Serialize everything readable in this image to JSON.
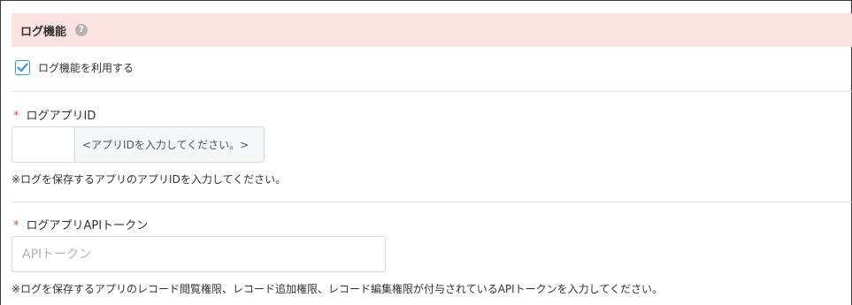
{
  "section": {
    "title": "ログ機能",
    "help_icon": "question-circle-icon",
    "help_glyph": "?"
  },
  "use_log": {
    "label": "ログ機能を利用する",
    "checked": true
  },
  "log_app_id": {
    "required_mark": "*",
    "label": "ログアプリID",
    "value": "",
    "addon_text": "<アプリIDを入力してください。>",
    "hint": "※ログを保存するアプリのアプリIDを入力してください。"
  },
  "api_token": {
    "required_mark": "*",
    "label": "ログアプリAPIトークン",
    "placeholder": "APIトークン",
    "value": "",
    "hint": "※ログを保存するアプリのレコード閲覧権限、レコード追加権限、レコード編集権限が付与されているAPIトークンを入力してください。"
  },
  "colors": {
    "header_bg": "#fde2e2",
    "required": "#e74c3c",
    "checkbox_accent": "#3498db"
  }
}
